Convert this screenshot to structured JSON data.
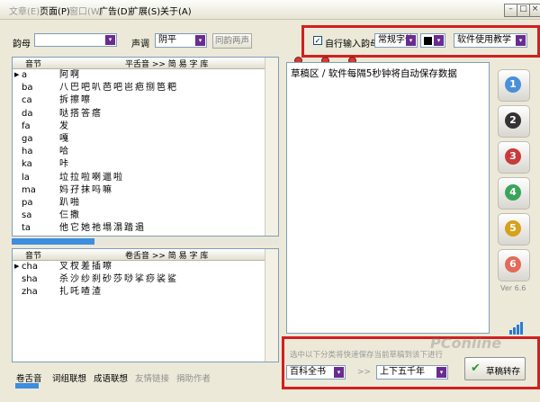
{
  "menu": {
    "items": [
      {
        "label": "文章(E)",
        "disabled": true
      },
      {
        "label": "页面(P)",
        "disabled": false
      },
      {
        "label": "窗口(W)",
        "disabled": true
      },
      {
        "label": "广告(D)",
        "disabled": false
      },
      {
        "label": "扩展(S)",
        "disabled": false
      },
      {
        "label": "关于(A)",
        "disabled": false
      }
    ]
  },
  "toolbar": {
    "rhyme_label": "韵母",
    "tone_label": "声调",
    "tone_value": "阴平",
    "same_rhyme_button": "同韵两声",
    "auto_input_label": "自行输入韵母",
    "font_value": "常规字体",
    "tutorial_value": "软件使用教学"
  },
  "grid1": {
    "header_pinyin": "音节",
    "header_title": "平舌音 >> 简 易 字 库",
    "rows": [
      {
        "py": "a",
        "ch": "阿啊"
      },
      {
        "py": "ba",
        "ch": "八巴吧叭芭吧岜疤捌笆粑"
      },
      {
        "py": "ca",
        "ch": "拆擦嚓"
      },
      {
        "py": "da",
        "ch": "哒搭答瘩"
      },
      {
        "py": "fa",
        "ch": "发"
      },
      {
        "py": "ga",
        "ch": "嘎"
      },
      {
        "py": "ha",
        "ch": "哈"
      },
      {
        "py": "ka",
        "ch": "咔"
      },
      {
        "py": "la",
        "ch": "垃拉啦喇邋啦"
      },
      {
        "py": "ma",
        "ch": "妈孖抹吗嘛"
      },
      {
        "py": "pa",
        "ch": "趴啪"
      },
      {
        "py": "sa",
        "ch": "仨撒"
      },
      {
        "py": "ta",
        "ch": "他它她祂塌溻踏遢"
      }
    ]
  },
  "grid2": {
    "header_pinyin": "音节",
    "header_title": "卷舌音 >> 简 易 字 库",
    "rows": [
      {
        "py": "cha",
        "ch": "叉杈差插嚓"
      },
      {
        "py": "sha",
        "ch": "杀沙纱刹砂莎唦挲痧裟鲨"
      },
      {
        "py": "zha",
        "ch": "扎吒喳渣"
      }
    ]
  },
  "tabs": [
    {
      "label": "卷舌音",
      "active": true
    },
    {
      "label": "词组联想",
      "active": false
    },
    {
      "label": "成语联想",
      "active": false
    },
    {
      "label": "友情链接",
      "active": false
    },
    {
      "label": "捐助作者",
      "active": false
    }
  ],
  "editor": {
    "header_text": "草稿区 / 软件每隔5秒钟将自动保存数据"
  },
  "save_panel": {
    "hint": "选中以下分类将快速保存当前草稿到该下进行",
    "category_value": "百科全书",
    "arrow_text": ">>",
    "subcategory_value": "上下五千年",
    "save_button": "草稿转存"
  },
  "side_buttons": [
    {
      "number": "1",
      "color": "#4a90d9"
    },
    {
      "number": "2",
      "color": "#333333"
    },
    {
      "number": "3",
      "color": "#c93b3b"
    },
    {
      "number": "4",
      "color": "#3aa55a"
    },
    {
      "number": "5",
      "color": "#d6a21c"
    },
    {
      "number": "6",
      "color": "#e26a5a"
    }
  ],
  "version": "Ver 6.6",
  "watermark": "PConline",
  "colors": {
    "accent": "#6a2c8f",
    "highlight_red": "#d21f1f",
    "tab_active": "#3d8de0"
  }
}
